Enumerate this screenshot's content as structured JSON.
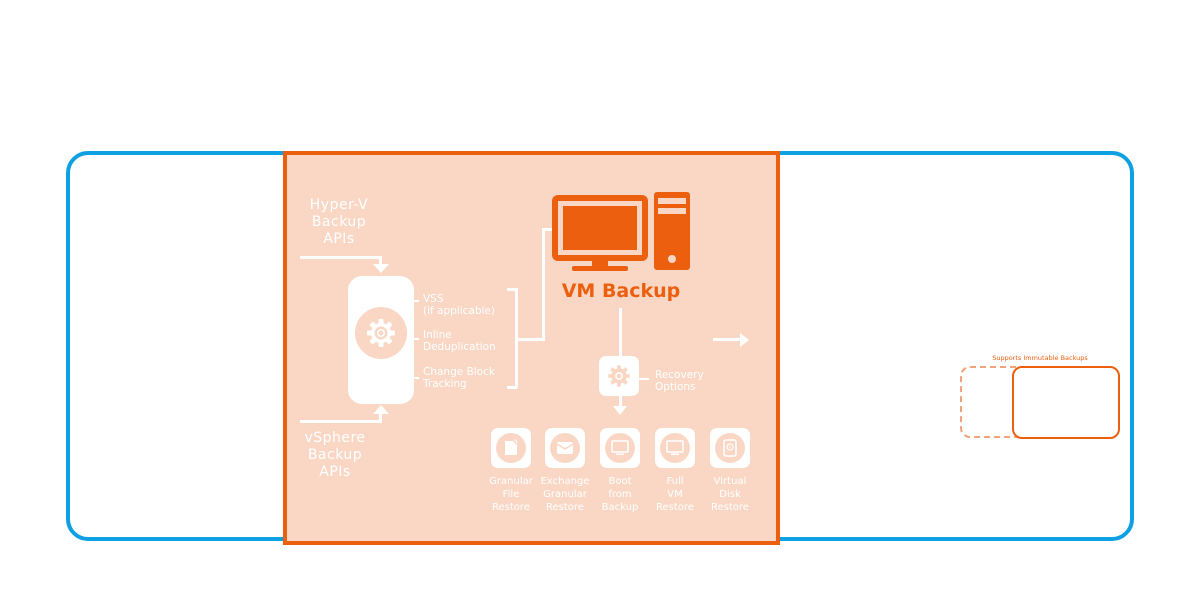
{
  "diagram": {
    "sources": {
      "top": "Hyper-V\nBackup\nAPIs",
      "top_lines": [
        "Hyper-V",
        "Backup",
        "APIs"
      ],
      "bottom_lines": [
        "vSphere",
        "Backup",
        "APIs"
      ]
    },
    "engine_features": [
      {
        "lines": [
          "VSS",
          "(if applicable)"
        ]
      },
      {
        "lines": [
          "Inline",
          "Deduplication"
        ]
      },
      {
        "lines": [
          "Change Block",
          "Tracking"
        ]
      }
    ],
    "target": {
      "title": "VM Backup",
      "icon": "computer-icon"
    },
    "recovery": {
      "label_lines": [
        "Recovery",
        "Options"
      ],
      "icon": "gear-icon"
    },
    "restore_options": [
      {
        "icon": "file-icon",
        "lines": [
          "Granular",
          "File",
          "Restore"
        ]
      },
      {
        "icon": "envelope-icon",
        "lines": [
          "Exchange",
          "Granular",
          "Restore"
        ]
      },
      {
        "icon": "monitor-icon",
        "lines": [
          "Boot",
          "from",
          "Backup"
        ]
      },
      {
        "icon": "monitor-icon",
        "lines": [
          "Full",
          "VM",
          "Restore"
        ]
      },
      {
        "icon": "disk-icon",
        "lines": [
          "Virtual",
          "Disk",
          "Restore"
        ]
      }
    ],
    "storage": {
      "label": "Supports Immutable Backups"
    },
    "colors": {
      "outer_border": "#0ea0e2",
      "accent": "#ec5f0f",
      "panel_fill": "#f9d7c4",
      "dashed_border": "#f2a37a"
    }
  }
}
